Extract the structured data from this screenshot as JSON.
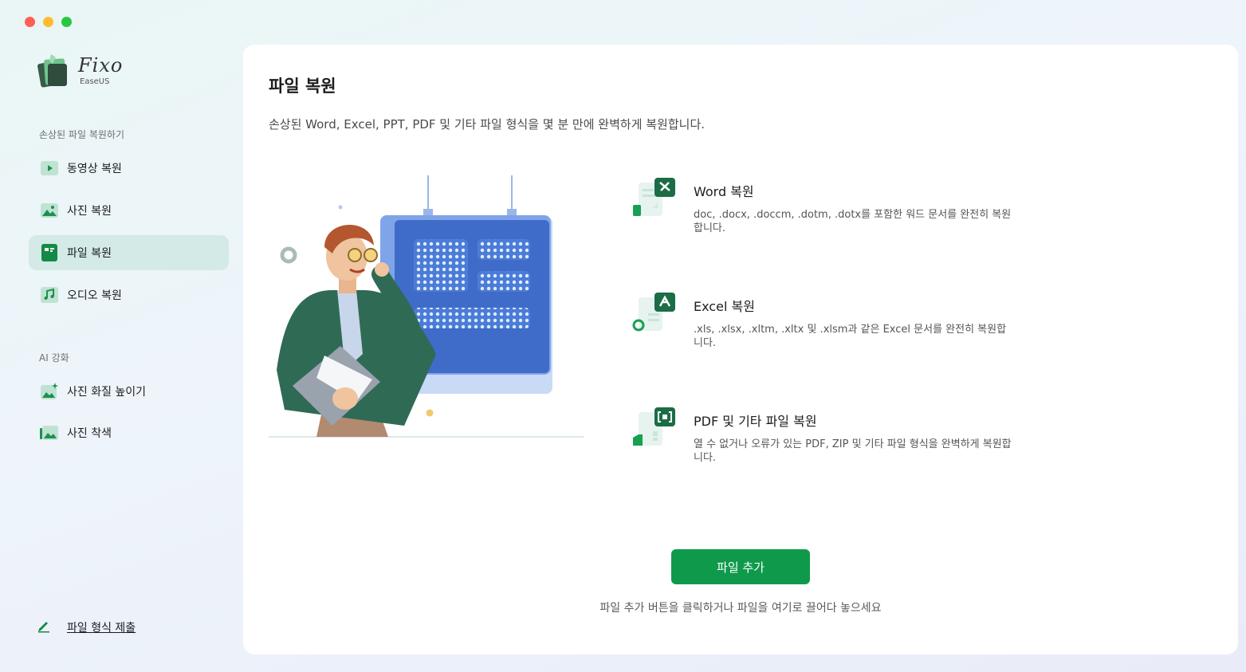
{
  "app": {
    "name": "Fixo",
    "brand": "EaseUS",
    "accent_color": "#0f9a4b",
    "active_bg_color": "#d3eae7"
  },
  "sidebar": {
    "section1_label": "손상된 파일 복원하기",
    "section1_items": [
      {
        "label": "동영상 복원",
        "icon": "video-icon"
      },
      {
        "label": "사진 복원",
        "icon": "photo-icon"
      },
      {
        "label": "파일 복원",
        "icon": "document-icon",
        "active": true
      },
      {
        "label": "오디오 복원",
        "icon": "music-icon"
      }
    ],
    "section2_label": "AI 강화",
    "section2_items": [
      {
        "label": "사진 화질 높이기",
        "icon": "photo-enhance-icon"
      },
      {
        "label": "사진 착색",
        "icon": "photo-colorize-icon"
      }
    ],
    "submit_label": "파일 형식 제출"
  },
  "main": {
    "title": "파일 복원",
    "description": "손상된 Word, Excel, PPT, PDF 및 기타 파일 형식을 몇 분 만에 완벽하게 복원합니다.",
    "features": [
      {
        "title": "Word 복원",
        "desc": "doc, .docx, .doccm, .dotm, .dotx를 포함한 워드 문서를 완전히 복원합니다.",
        "icon": "word-file-icon"
      },
      {
        "title": "Excel 복원",
        "desc": ".xls, .xlsx, .xltm, .xltx 및 .xlsm과 같은 Excel 문서를 완전히 복원합니다.",
        "icon": "excel-file-icon"
      },
      {
        "title": "PDF 및 기타 파일 복원",
        "desc": "열 수 없거나 오류가 있는 PDF, ZIP 및 기타 파일 형식을 완벽하게 복원합니다.",
        "icon": "pdf-file-icon"
      }
    ],
    "add_button_label": "파일 추가",
    "drop_hint": "파일 추가 버튼을 클릭하거나 파일을 여기로 끌어다 놓으세요"
  }
}
